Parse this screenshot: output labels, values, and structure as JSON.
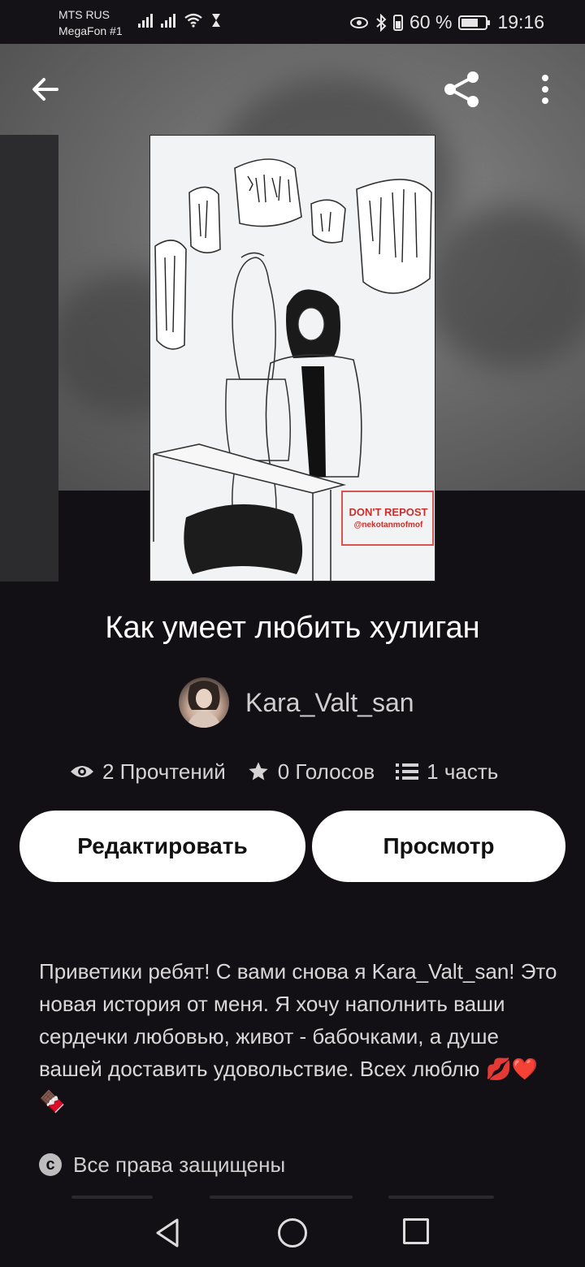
{
  "status_bar": {
    "carrier_1": "MTS RUS",
    "carrier_2": "MegaFon #1",
    "battery": "60 %",
    "time": "19:16"
  },
  "header": {
    "back_icon": "arrow-left-icon",
    "share_icon": "share-icon",
    "more_icon": "more-vertical-icon"
  },
  "cover": {
    "watermark_line_1": "DON'T REPOST",
    "watermark_line_2": "@nekotanmofmof"
  },
  "story": {
    "title": "Как умеет любить хулиган",
    "author": "Kara_Valt_san",
    "stats": {
      "reads": "2 Прочтений",
      "votes": "0 Голосов",
      "parts": "1 часть"
    },
    "description": "Приветики ребят! С вами снова я Kara_Valt_san! Это новая история от меня. Я хочу наполнить ваши сердечки любовью, живот - бабочками, а душе вашей доставить удовольствие. Всех люблю 💋❤️🍫",
    "copyright": "Все права защищены"
  },
  "actions": {
    "edit_label": "Редактировать",
    "view_label": "Просмотр"
  },
  "colors": {
    "background": "#121014",
    "button_bg": "#ffffff",
    "button_text": "#111111"
  }
}
